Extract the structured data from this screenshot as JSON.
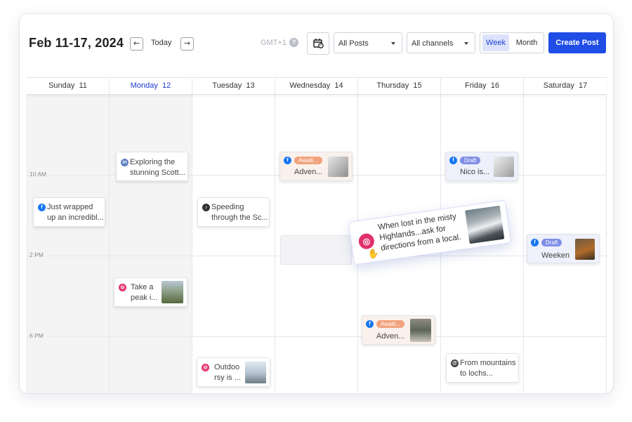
{
  "header": {
    "date_range": "Feb 11-17, 2024",
    "prev_icon": "←",
    "next_icon": "→",
    "today_label": "Today",
    "timezone": "GMT+1",
    "help_icon": "?",
    "posts_filter": "All Posts",
    "channels_filter": "All channels",
    "view_week": "Week",
    "view_month": "Month",
    "create_post": "Create Post"
  },
  "days": [
    {
      "name": "Sunday",
      "num": "11"
    },
    {
      "name": "Monday",
      "num": "12"
    },
    {
      "name": "Tuesday",
      "num": "13"
    },
    {
      "name": "Wednesday",
      "num": "14"
    },
    {
      "name": "Thursday",
      "num": "15"
    },
    {
      "name": "Friday",
      "num": "16"
    },
    {
      "name": "Saturday",
      "num": "17"
    }
  ],
  "time_labels": [
    "10 AM",
    "2 PM",
    "6 PM"
  ],
  "posts": {
    "mon_scotland": {
      "line1": "Exploring the",
      "line2": "stunning Scott..."
    },
    "sun_wrapped": {
      "line1": "Just wrapped",
      "line2": "up an incredibl..."
    },
    "tue_speeding": {
      "line1": "Speeding",
      "line2": "through the Sc..."
    },
    "wed_adven": {
      "badge": "Awaiti...",
      "line2": "Adven..."
    },
    "fri_nico": {
      "badge": "Draft",
      "line2": "Nico is..."
    },
    "sat_weeken": {
      "badge": "Draft",
      "line2": "Weeken"
    },
    "mon_peak": {
      "line1": "Take a",
      "line2": "peak i..."
    },
    "thu_adven": {
      "badge": "Awaiti...",
      "line2": "Adven..."
    },
    "tue_outdoo": {
      "line1": "Outdoo",
      "line2": "rsy is ..."
    },
    "fri_mountains": {
      "line1": "From mountains",
      "line2": "to lochs..."
    },
    "dragging": {
      "line1": "When lost in the misty",
      "line2": "Highlands...ask for",
      "line3": "directions from a local."
    }
  },
  "colors": {
    "accent": "#1f4de6",
    "facebook": "#1877f2",
    "instagram": "#e1306c",
    "tiktok": "#333333",
    "await_badge": "#f1a27c",
    "draft_badge": "#7f8fe6"
  }
}
